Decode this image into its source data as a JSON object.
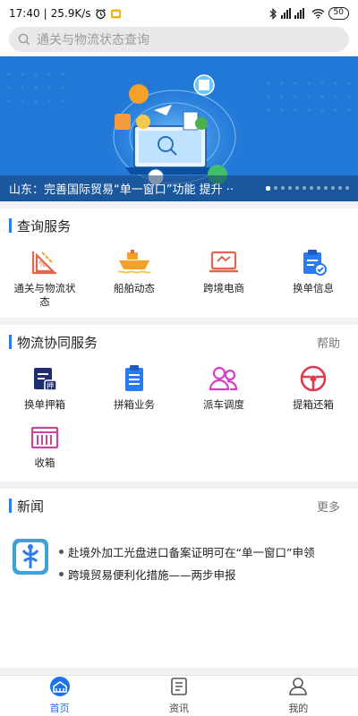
{
  "status_bar": {
    "time": "17:40",
    "speed": "25.9K/s",
    "battery": "50",
    "icons": [
      "alarm-icon",
      "app-notification-icon",
      "bluetooth-icon",
      "signal-icon",
      "wifi-icon",
      "battery-icon"
    ]
  },
  "search": {
    "placeholder": "通关与物流状态查询"
  },
  "banner": {
    "caption": "山东：完善国际贸易“单一窗口”功能 提升 ··",
    "dot_count": 12,
    "active_dot": 0
  },
  "query_services": {
    "title": "查询服务",
    "items": [
      {
        "label": "通关与物流状态",
        "icon": "customs-chart-icon"
      },
      {
        "label": "船舶动态",
        "icon": "ship-icon"
      },
      {
        "label": "跨境电商",
        "icon": "laptop-icon"
      },
      {
        "label": "换单信息",
        "icon": "clipboard-check-icon"
      }
    ]
  },
  "logistics_services": {
    "title": "物流协同服务",
    "more": "帮助",
    "items": [
      {
        "label": "换单押箱",
        "icon": "deposit-clipboard-icon"
      },
      {
        "label": "拼箱业务",
        "icon": "document-list-icon"
      },
      {
        "label": "派车调度",
        "icon": "team-icon"
      },
      {
        "label": "提箱还箱",
        "icon": "steering-wheel-icon"
      },
      {
        "label": "收箱",
        "icon": "container-icon"
      }
    ]
  },
  "news": {
    "title": "新闻",
    "more": "更多",
    "items": [
      "赴境外加工光盘进口备案证明可在“单一窗口”申领",
      "跨境贸易便利化措施——两步申报"
    ]
  },
  "bottom_nav": {
    "items": [
      {
        "label": "首页",
        "icon": "home-icon",
        "active": true
      },
      {
        "label": "资讯",
        "icon": "news-icon",
        "active": false
      },
      {
        "label": "我的",
        "icon": "profile-icon",
        "active": false
      }
    ]
  },
  "colors": {
    "accent": "#2a7cf0",
    "banner_blue": "#1d6fd0",
    "nav_active": "#1a73e8"
  }
}
